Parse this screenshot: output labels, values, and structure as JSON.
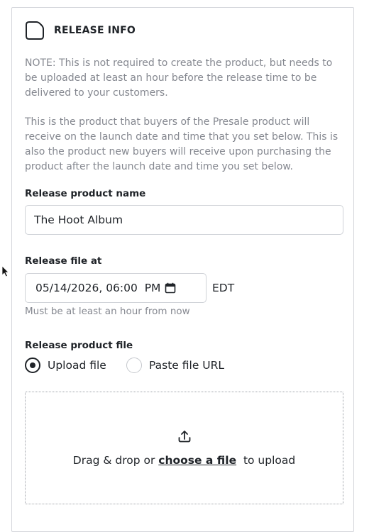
{
  "section": {
    "icon": "document-icon",
    "title": "RELEASE INFO",
    "note": "NOTE: This is not required to create the product, but needs to be uploaded at least an hour before the release time to be delivered to your customers.",
    "description": "This is the product that buyers of the Presale product will receive on the launch date and time that you set below. This is also the product new buyers will receive upon purchasing the product after the launch date and time you set below."
  },
  "release_name": {
    "label": "Release product name",
    "value": "The Hoot Album"
  },
  "release_time": {
    "label": "Release file at",
    "value": "05/14/2026, 06:00  PM",
    "timezone": "EDT",
    "hint": "Must be at least an hour from now",
    "icon": "calendar-icon"
  },
  "release_file": {
    "label": "Release product file",
    "options": [
      {
        "label": "Upload file",
        "selected": true
      },
      {
        "label": "Paste file URL",
        "selected": false
      }
    ],
    "dropzone": {
      "icon": "upload-icon",
      "text_before": "Drag & drop or ",
      "link": "choose a file",
      "text_after": "  to upload"
    }
  }
}
